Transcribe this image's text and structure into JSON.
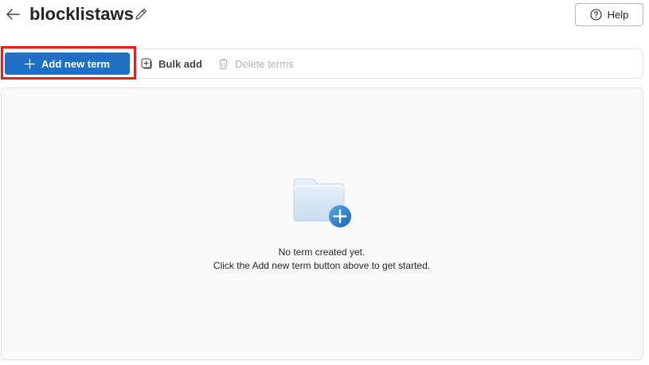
{
  "header": {
    "title": "blocklistaws",
    "help_label": "Help"
  },
  "toolbar": {
    "add_label": "Add new term",
    "bulk_label": "Bulk add",
    "delete_label": "Delete terms"
  },
  "empty_state": {
    "line1": "No term created yet.",
    "line2": "Click the Add new term button above to get started."
  },
  "colors": {
    "accent": "#1f6fc5",
    "highlight": "#e81e1e",
    "disabled_text": "#b5b5b5"
  },
  "icons": {
    "back": "arrow-left-icon",
    "edit": "pencil-icon",
    "help": "question-circle-icon",
    "add": "plus-icon",
    "bulk": "add-square-icon",
    "delete": "trash-icon",
    "illustration": "folder-add-icon"
  }
}
